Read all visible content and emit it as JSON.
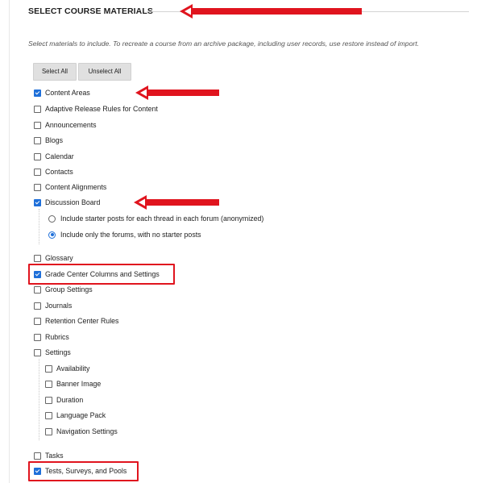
{
  "section": {
    "title": "SELECT COURSE MATERIALS",
    "instructions": "Select materials to include. To recreate a course from an archive package, including user records, use restore instead of import."
  },
  "buttons": {
    "select_all": "Select All",
    "unselect_all": "Unselect All"
  },
  "items": [
    {
      "label": "Content Areas",
      "checked": true
    },
    {
      "label": "Adaptive Release Rules for Content",
      "checked": false
    },
    {
      "label": "Announcements",
      "checked": false
    },
    {
      "label": "Blogs",
      "checked": false
    },
    {
      "label": "Calendar",
      "checked": false
    },
    {
      "label": "Contacts",
      "checked": false
    },
    {
      "label": "Content Alignments",
      "checked": false
    },
    {
      "label": "Discussion Board",
      "checked": true
    },
    {
      "label": "Include starter posts for each thread in each forum (anonymized)",
      "selected": false
    },
    {
      "label": "Include only the forums, with no starter posts",
      "selected": true
    },
    {
      "label": "Glossary",
      "checked": false
    },
    {
      "label": "Grade Center Columns and Settings",
      "checked": true
    },
    {
      "label": "Group Settings",
      "checked": false
    },
    {
      "label": "Journals",
      "checked": false
    },
    {
      "label": "Retention Center Rules",
      "checked": false
    },
    {
      "label": "Rubrics",
      "checked": false
    },
    {
      "label": "Settings",
      "checked": false
    },
    {
      "label": "Availability",
      "checked": false
    },
    {
      "label": "Banner Image",
      "checked": false
    },
    {
      "label": "Duration",
      "checked": false
    },
    {
      "label": "Language Pack",
      "checked": false
    },
    {
      "label": "Navigation Settings",
      "checked": false
    },
    {
      "label": "Tasks",
      "checked": false
    },
    {
      "label": "Tests, Surveys, and Pools",
      "checked": true
    }
  ],
  "colors": {
    "accent": "#1e6fd9",
    "annotation": "#e0141e"
  }
}
